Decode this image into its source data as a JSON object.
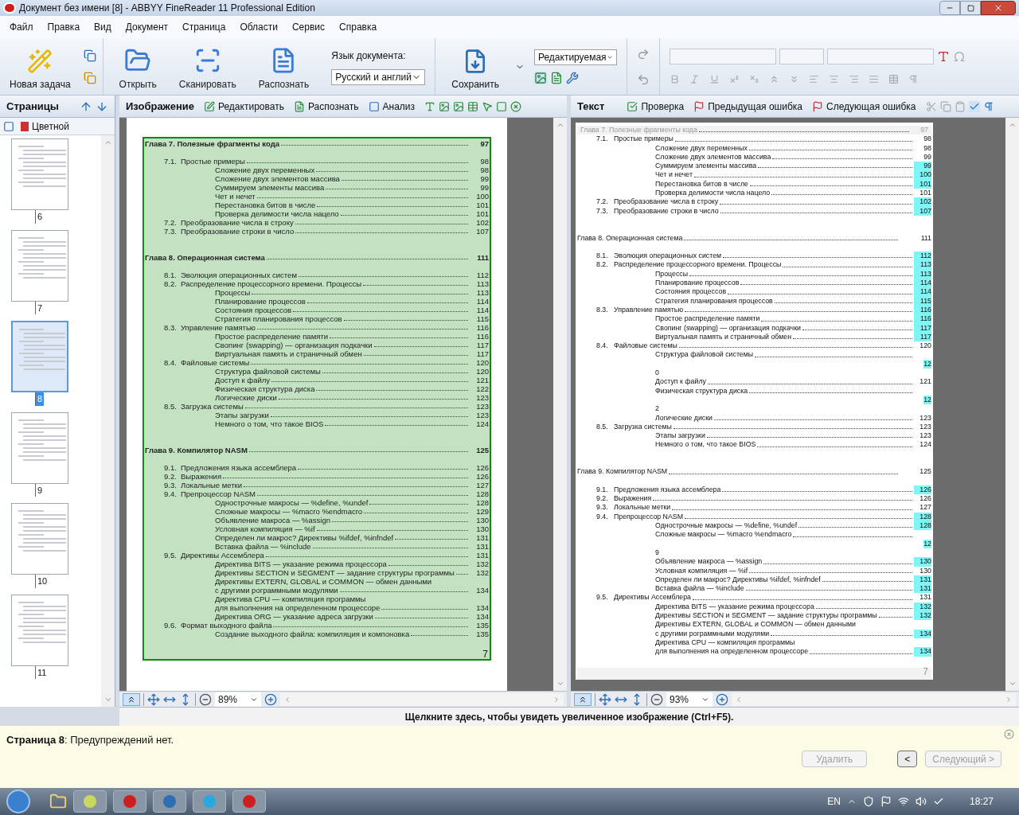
{
  "window": {
    "title": "Документ без имени [8] - ABBYY FineReader 11 Professional Edition"
  },
  "menu": [
    "Файл",
    "Правка",
    "Вид",
    "Документ",
    "Страница",
    "Области",
    "Сервис",
    "Справка"
  ],
  "toolbar": {
    "new_task": "Новая задача",
    "open": "Открыть",
    "scan": "Сканировать",
    "recognize": "Распознать",
    "language_label": "Язык документа:",
    "language": "Русский и англий",
    "save": "Сохранить",
    "mode": "Редактируемая"
  },
  "sidebar": {
    "title": "Страницы",
    "color_mode": "Цветной",
    "thumbnails": [
      {
        "number": "6",
        "selected": false
      },
      {
        "number": "7",
        "selected": false
      },
      {
        "number": "8",
        "selected": true
      },
      {
        "number": "9",
        "selected": false
      },
      {
        "number": "10",
        "selected": false
      },
      {
        "number": "11",
        "selected": false
      }
    ]
  },
  "image_panel": {
    "title": "Изображение",
    "actions": [
      "Редактировать",
      "Распознать",
      "Анализ"
    ],
    "zoom": "89%",
    "footer": "7",
    "entries": [
      {
        "kind": "chapter",
        "title": "Глава 7. Полезные фрагменты кода",
        "page": "97"
      },
      {
        "kind": "gap"
      },
      {
        "kind": "section",
        "num": "7.1.",
        "title": "Простые примеры",
        "page": "98"
      },
      {
        "kind": "sub",
        "title": "Сложение двух переменных",
        "page": "98"
      },
      {
        "kind": "sub",
        "title": "Сложение двух элементов массива",
        "page": "99"
      },
      {
        "kind": "sub",
        "title": "Суммируем элементы массива",
        "page": "99"
      },
      {
        "kind": "sub",
        "title": "Чет и нечет",
        "page": "100"
      },
      {
        "kind": "sub",
        "title": "Перестановка битов в числе",
        "page": "101"
      },
      {
        "kind": "sub",
        "title": "Проверка делимости числа нацело",
        "page": "101"
      },
      {
        "kind": "section",
        "num": "7.2.",
        "title": "Преобразование числа в строку",
        "page": "102"
      },
      {
        "kind": "section",
        "num": "7.3.",
        "title": "Преобразование строки в число",
        "page": "107"
      },
      {
        "kind": "gap"
      },
      {
        "kind": "gap"
      },
      {
        "kind": "chapter",
        "title": "Глава 8. Операционная система",
        "page": "111"
      },
      {
        "kind": "gap"
      },
      {
        "kind": "section",
        "num": "8.1.",
        "title": "Эволюция операционных систем",
        "page": "112"
      },
      {
        "kind": "section",
        "num": "8.2.",
        "title": "Распределение процессорного времени. Процессы",
        "page": "113"
      },
      {
        "kind": "sub",
        "title": "Процессы",
        "page": "113"
      },
      {
        "kind": "sub",
        "title": "Планирование процессов",
        "page": "114"
      },
      {
        "kind": "sub",
        "title": "Состояния процессов",
        "page": "114"
      },
      {
        "kind": "sub",
        "title": "Стратегия планирования процессов",
        "page": "115"
      },
      {
        "kind": "section",
        "num": "8.3.",
        "title": "Управление памятью",
        "page": "116"
      },
      {
        "kind": "sub",
        "title": "Простое распределение памяти",
        "page": "116"
      },
      {
        "kind": "sub",
        "title": "Свопинг (swapping) — организация подкачки",
        "page": "117"
      },
      {
        "kind": "sub",
        "title": "Виртуальная память и страничный обмен",
        "page": "117"
      },
      {
        "kind": "section",
        "num": "8.4.",
        "title": "Файловые системы",
        "page": "120"
      },
      {
        "kind": "sub",
        "title": "Структура файловой системы",
        "page": "120"
      },
      {
        "kind": "sub",
        "title": "Доступ к файлу",
        "page": "121"
      },
      {
        "kind": "sub",
        "title": "Физическая структура диска",
        "page": "122"
      },
      {
        "kind": "sub",
        "title": "Логические диски",
        "page": "123"
      },
      {
        "kind": "section",
        "num": "8.5.",
        "title": "Загрузка системы",
        "page": "123"
      },
      {
        "kind": "sub",
        "title": "Этапы загрузки",
        "page": "123"
      },
      {
        "kind": "sub",
        "title": "Немного о том, что такое BIOS",
        "page": "124"
      },
      {
        "kind": "gap"
      },
      {
        "kind": "gap"
      },
      {
        "kind": "chapter",
        "title": "Глава 9. Компилятор NASM",
        "page": "125"
      },
      {
        "kind": "gap"
      },
      {
        "kind": "section",
        "num": "9.1.",
        "title": "Предложения языка ассемблера",
        "page": "126"
      },
      {
        "kind": "section",
        "num": "9.2.",
        "title": "Выражения",
        "page": "126"
      },
      {
        "kind": "section",
        "num": "9.3.",
        "title": "Локальные метки",
        "page": "127"
      },
      {
        "kind": "section",
        "num": "9.4.",
        "title": "Препроцессор NASM",
        "page": "128"
      },
      {
        "kind": "sub",
        "title": "Однострочные макросы — %define, %undef",
        "page": "128"
      },
      {
        "kind": "sub",
        "title": "Сложные макросы — %macro %endmacro",
        "page": "129"
      },
      {
        "kind": "sub",
        "title": "Объявление макроса — %assign",
        "page": "130"
      },
      {
        "kind": "sub",
        "title": "Условная компиляция — %if",
        "page": "130"
      },
      {
        "kind": "sub",
        "title": "Определен ли макрос? Директивы %ifdef, %infndef",
        "page": "131"
      },
      {
        "kind": "sub",
        "title": "Вставка файла — %include",
        "page": "131"
      },
      {
        "kind": "section",
        "num": "9.5.",
        "title": "Директивы Ассемблера",
        "page": "131"
      },
      {
        "kind": "sub",
        "title": "Директива BITS — указание режима процессора",
        "page": "132"
      },
      {
        "kind": "sub",
        "title": "Директивы SECTION и SEGMENT — задание структуры программы",
        "page": "132"
      },
      {
        "kind": "line",
        "title": "Директивы EXTERN, GLOBAL и COMMON — обмен данными"
      },
      {
        "kind": "sub",
        "title": "с другими рограммными модулями",
        "page": "134"
      },
      {
        "kind": "line",
        "title": "Директива CPU — компиляция программы"
      },
      {
        "kind": "sub",
        "title": "для выполнения на определенном процессоре",
        "page": "134"
      },
      {
        "kind": "sub",
        "title": "Директива ORG — указание адреса загрузки",
        "page": "134"
      },
      {
        "kind": "section",
        "num": "9.6.",
        "title": "Формат выходного файла",
        "page": "135"
      },
      {
        "kind": "sub",
        "title": "Создание выходного файла: компиляция и компоновка",
        "page": "135"
      }
    ]
  },
  "text_panel": {
    "title": "Текст",
    "actions": [
      "Проверка",
      "Предыдущая ошибка",
      "Следующая ошибка"
    ],
    "zoom": "93%",
    "footer": "7",
    "entries": [
      {
        "kind": "header",
        "title": "Глава 7. Полезные фрагменты кода",
        "page": "97"
      },
      {
        "kind": "section",
        "num": "7.1.",
        "title": "Простые примеры",
        "page": "98",
        "flagged": false
      },
      {
        "kind": "sub",
        "title": "Сложение двух переменных",
        "page": "98",
        "flagged": false
      },
      {
        "kind": "sub",
        "title": "Сложение двух элементов массива",
        "page": "99",
        "flagged": false
      },
      {
        "kind": "sub",
        "title": "Суммируем элементы массива",
        "page": "99",
        "flagged": true
      },
      {
        "kind": "sub",
        "title": "Чет и нечет",
        "page": "100",
        "flagged": true
      },
      {
        "kind": "sub",
        "title": "Перестановка битов в числе",
        "page": "101",
        "flagged": true
      },
      {
        "kind": "sub",
        "title": "Проверка делимости числа нацело",
        "page": "101",
        "flagged": false
      },
      {
        "kind": "section",
        "num": "7.2.",
        "title": "Преобразование числа в строку",
        "page": "102",
        "flagged": true
      },
      {
        "kind": "section",
        "num": "7.3.",
        "title": "Преобразование строки в число",
        "page": "107",
        "flagged": true
      },
      {
        "kind": "gap"
      },
      {
        "kind": "gap"
      },
      {
        "kind": "chapter",
        "title": "Глава 8. Операционная система",
        "page": "111"
      },
      {
        "kind": "gap"
      },
      {
        "kind": "section",
        "num": "8.1.",
        "title": "Эволюция операционных систем",
        "page": "112",
        "flagged": true
      },
      {
        "kind": "section",
        "num": "8.2.",
        "title": "Распределение процессорного времени. Процессы",
        "page": "113",
        "flagged": true
      },
      {
        "kind": "sub",
        "title": "Процессы",
        "page": "113",
        "flagged": true
      },
      {
        "kind": "sub",
        "title": "Планирование процессов",
        "page": "114",
        "flagged": true
      },
      {
        "kind": "sub",
        "title": "Состояния процессов",
        "page": "114",
        "flagged": true
      },
      {
        "kind": "sub",
        "title": "Стратегия планирования процессов",
        "page": "115",
        "flagged": true
      },
      {
        "kind": "section",
        "num": "8.3.",
        "title": "Управление памятью",
        "page": "116",
        "flagged": true
      },
      {
        "kind": "sub",
        "title": "Простое распределение памяти",
        "page": "116",
        "flagged": true
      },
      {
        "kind": "sub",
        "title": "Свопинг (swapping) — организация подкачки",
        "page": "117",
        "flagged": true
      },
      {
        "kind": "sub",
        "title": "Виртуальная память и страничный обмен",
        "page": "117",
        "flagged": true
      },
      {
        "kind": "section",
        "num": "8.4.",
        "title": "Файловые системы",
        "page": "120",
        "flagged": false
      },
      {
        "kind": "sub",
        "title": "Структура файловой системы"
      },
      {
        "kind": "page_only",
        "page": "12",
        "flagged": true
      },
      {
        "kind": "fragment",
        "title": "0"
      },
      {
        "kind": "sub",
        "title": "Доступ к файлу",
        "page": "121",
        "flagged": false
      },
      {
        "kind": "sub",
        "title": "Физическая структура диска"
      },
      {
        "kind": "page_only",
        "page": "12",
        "flagged": true
      },
      {
        "kind": "fragment",
        "title": "2"
      },
      {
        "kind": "sub",
        "title": "Логические диски",
        "page": "123",
        "flagged": false
      },
      {
        "kind": "section",
        "num": "8.5.",
        "title": "Загрузка системы",
        "page": "123",
        "flagged": false
      },
      {
        "kind": "sub",
        "title": "Этапы загрузки",
        "page": "123",
        "flagged": false
      },
      {
        "kind": "sub",
        "title": "Немного о том, что такое BIOS",
        "page": "124",
        "flagged": false
      },
      {
        "kind": "gap"
      },
      {
        "kind": "gap"
      },
      {
        "kind": "chapter",
        "title": "Глава 9. Компилятор NASM",
        "page": "125"
      },
      {
        "kind": "gap"
      },
      {
        "kind": "section",
        "num": "9.1.",
        "title": "Предложения языка ассемблера",
        "page": "126",
        "flagged": true
      },
      {
        "kind": "section",
        "num": "9.2.",
        "title": "Выражения",
        "page": "126",
        "flagged": false
      },
      {
        "kind": "section",
        "num": "9.3.",
        "title": "Локальные метки",
        "page": "127",
        "flagged": false
      },
      {
        "kind": "section",
        "num": "9.4.",
        "title": "Препроцессор NASM",
        "page": "128",
        "flagged": true
      },
      {
        "kind": "sub",
        "title": "Однострочные макросы — %define, %undef",
        "page": "128",
        "flagged": true
      },
      {
        "kind": "sub",
        "title": "Сложные макросы — %macro %endmacro"
      },
      {
        "kind": "page_only",
        "page": "12",
        "flagged": true
      },
      {
        "kind": "fragment",
        "title": "9"
      },
      {
        "kind": "sub",
        "title": "Объявление макроса — %assign",
        "page": "130",
        "flagged": true
      },
      {
        "kind": "sub",
        "title": "Условная компиляция — %if",
        "page": "130",
        "flagged": false
      },
      {
        "kind": "sub",
        "title": "Определен ли макрос? Директивы %ifdef, %infndef",
        "page": "131",
        "flagged": true
      },
      {
        "kind": "sub",
        "title": "Вставка файла — %include",
        "page": "131",
        "flagged": true
      },
      {
        "kind": "section",
        "num": "9.5.",
        "title": "Директивы Ассемблера",
        "page": "131",
        "flagged": false
      },
      {
        "kind": "sub",
        "title": "Директива BITS — указание режима процессора",
        "page": "132",
        "flagged": true
      },
      {
        "kind": "sub",
        "title": "Директивы SECTION и SEGMENT — задание структуры программы",
        "page": "132",
        "flagged": true
      },
      {
        "kind": "line",
        "title": "Директивы EXTERN, GLOBAL и COMMON — обмен данными"
      },
      {
        "kind": "sub",
        "title": "с другими рограммными модулями",
        "page": "134",
        "flagged": true
      },
      {
        "kind": "line",
        "title": "Директива CPU — компиляция программы"
      },
      {
        "kind": "sub",
        "title": "для выполнения на определенном процессоре",
        "page": "134",
        "flagged": true
      }
    ]
  },
  "zoom_hint": "Щелкните здесь, чтобы увидеть увеличенное изображение (Ctrl+F5).",
  "warnings": {
    "message": "**Страница 8**: Предупреждений нет.",
    "buttons": [
      {
        "label": "Удалить",
        "disabled": true
      },
      {
        "label": "<",
        "disabled": false
      },
      {
        "label": "Следующий >",
        "disabled": true
      }
    ]
  },
  "taskbar": {
    "language": "EN",
    "time": "18:27"
  }
}
